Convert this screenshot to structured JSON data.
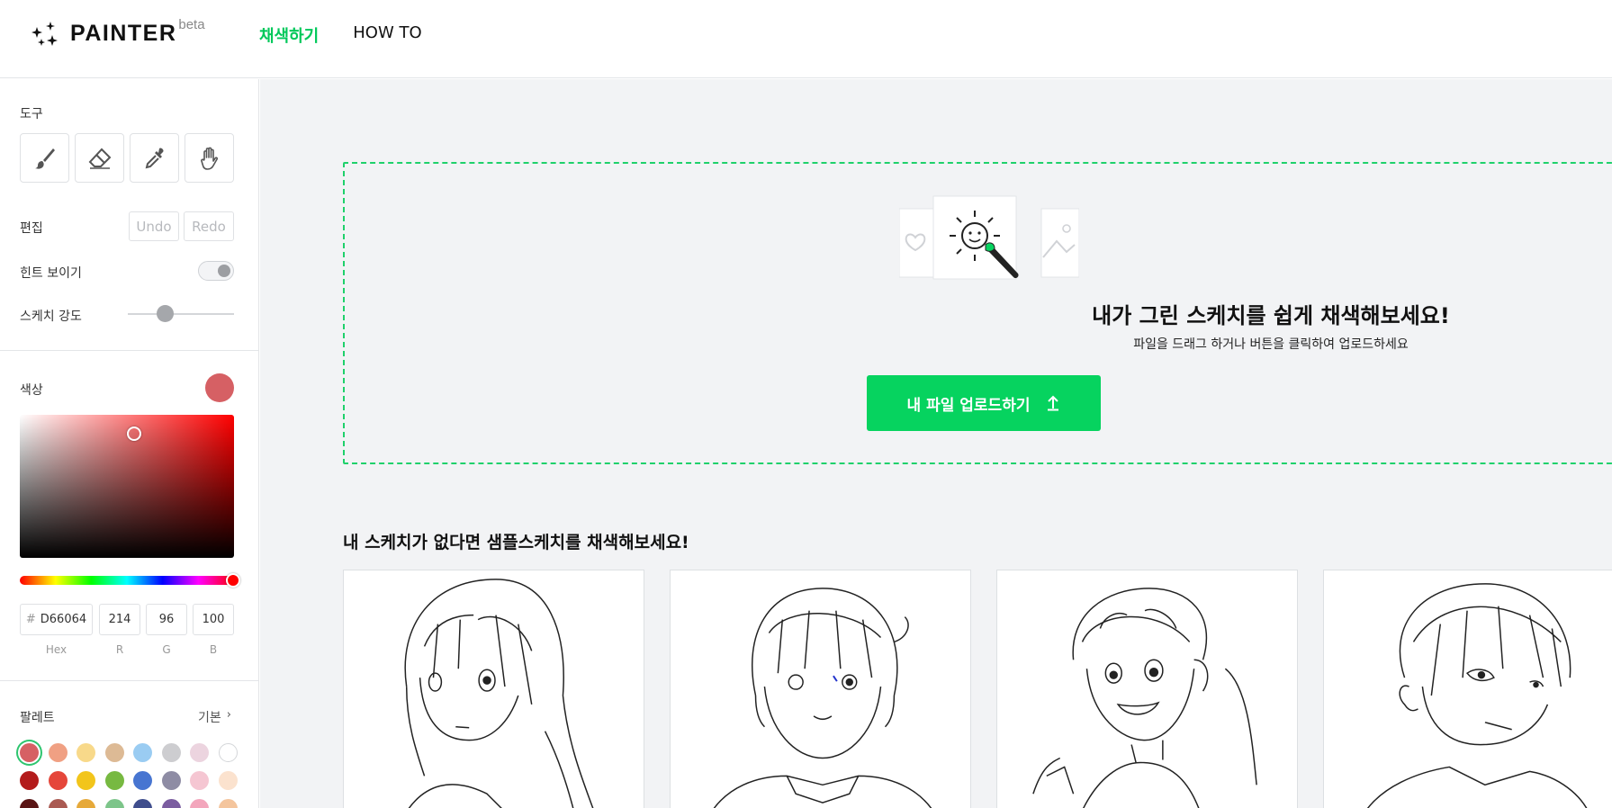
{
  "header": {
    "logo_text": "PAINTER",
    "logo_badge": "beta",
    "nav": [
      "채색하기",
      "HOW TO"
    ]
  },
  "sidebar": {
    "tools_label": "도구",
    "tools": [
      "brush-icon",
      "eraser-icon",
      "eyedropper-icon",
      "hand-icon"
    ],
    "edit_label": "편집",
    "undo_label": "Undo",
    "redo_label": "Redo",
    "hint_label": "힌트 보이기",
    "hint_on": false,
    "sketch_label": "스케치 강도",
    "sketch_level": 0.35,
    "color_label": "색상",
    "current_color": "#D66064",
    "hex_prefix": "#",
    "hex": "D66064",
    "r": "214",
    "g": "96",
    "b": "100",
    "cap_hex": "Hex",
    "cap_r": "R",
    "cap_g": "G",
    "cap_b": "B",
    "palette_label": "팔레트",
    "palette_preset": "기본",
    "palette_rows": [
      [
        "#D66064",
        "#F0A083",
        "#F8D98A",
        "#DDBA95",
        "#9ACCF2",
        "#CDCDD0",
        "#ECD4DF",
        "#FFFFFF"
      ],
      [
        "#B31B1B",
        "#E5463A",
        "#F2C51B",
        "#77B941",
        "#4775D1",
        "#8E8CA4",
        "#F5C6D2",
        "#FBE2CE"
      ],
      [
        "#5A1515",
        "#AA5A52",
        "#E6A93A",
        "#7DC58A",
        "#3F4E8D",
        "#7B5DA0",
        "#F3A6BC",
        "#F4C59D"
      ]
    ]
  },
  "main": {
    "drop_title": "내가 그린 스케치를 쉽게 채색해보세요!",
    "drop_subtitle": "파일을 드래그 하거나 버튼을 클릭하여 업로드하세요",
    "upload_label": "내 파일 업로드하기",
    "samples_title": "내 스케치가 없다면 샘플스케치를 채색해보세요!",
    "samples": [
      "sample-sketch-1",
      "sample-sketch-2",
      "sample-sketch-3",
      "sample-sketch-4"
    ]
  },
  "colors": {
    "accent": "#06D35F",
    "nav_active": "#00C85A",
    "background": "#F2F3F5"
  }
}
